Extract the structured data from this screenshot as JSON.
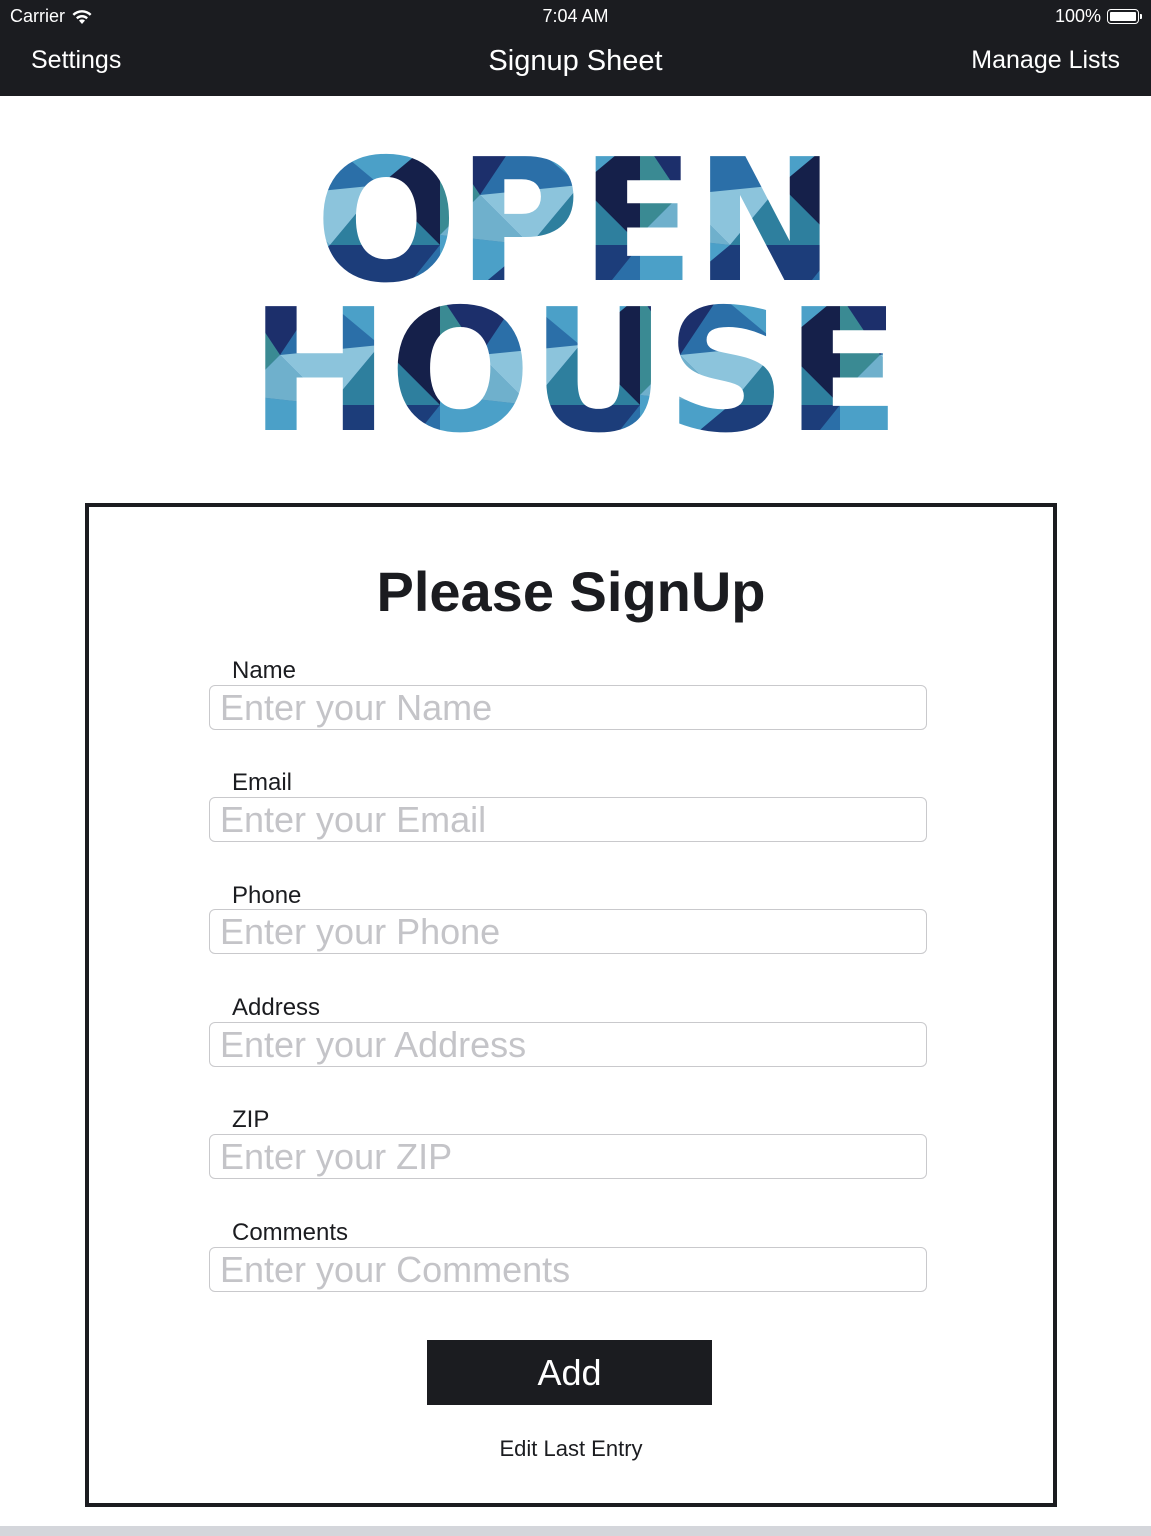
{
  "status_bar": {
    "carrier": "Carrier",
    "time": "7:04 AM",
    "battery": "100%"
  },
  "nav": {
    "left_label": "Settings",
    "title": "Signup Sheet",
    "right_label": "Manage Lists"
  },
  "logo": {
    "line1": "OPEN",
    "line2": "HOUSE",
    "colors": [
      "#1c2f6b",
      "#2b6fa8",
      "#4ba0c8",
      "#8cc4dc",
      "#3a8a93",
      "#15204a"
    ]
  },
  "form": {
    "heading": "Please SignUp",
    "fields": [
      {
        "label": "Name",
        "placeholder": "Enter your Name",
        "value": ""
      },
      {
        "label": "Email",
        "placeholder": "Enter your Email",
        "value": ""
      },
      {
        "label": "Phone",
        "placeholder": "Enter your Phone",
        "value": ""
      },
      {
        "label": "Address",
        "placeholder": "Enter your Address",
        "value": ""
      },
      {
        "label": "ZIP",
        "placeholder": "Enter your ZIP",
        "value": ""
      },
      {
        "label": "Comments",
        "placeholder": "Enter your Comments",
        "value": ""
      }
    ],
    "add_label": "Add",
    "edit_label": "Edit Last Entry"
  }
}
